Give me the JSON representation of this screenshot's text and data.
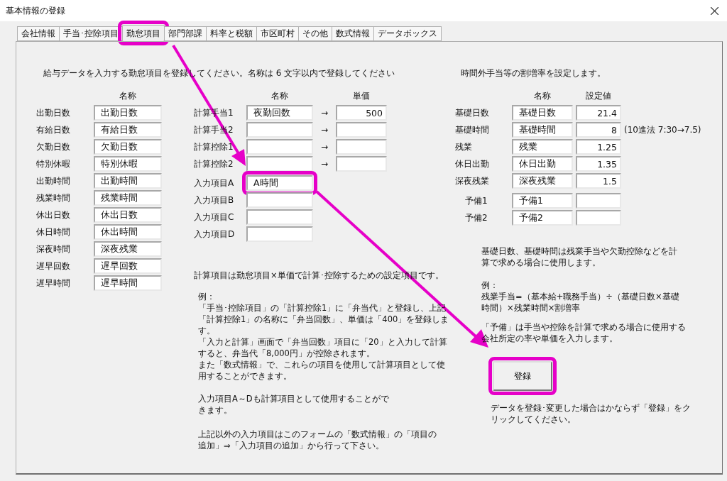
{
  "window": {
    "title": "基本情報の登録"
  },
  "tabs": [
    {
      "label": "会社情報",
      "selected": false,
      "highlighted": false
    },
    {
      "label": "手当･控除項目",
      "selected": false,
      "highlighted": false
    },
    {
      "label": "勤怠項目",
      "selected": true,
      "highlighted": true
    },
    {
      "label": "部門部課",
      "selected": false,
      "highlighted": false
    },
    {
      "label": "料率と税額",
      "selected": false,
      "highlighted": false
    },
    {
      "label": "市区町村",
      "selected": false,
      "highlighted": false
    },
    {
      "label": "その他",
      "selected": false,
      "highlighted": false
    },
    {
      "label": "数式情報",
      "selected": false,
      "highlighted": false
    },
    {
      "label": "データボックス",
      "selected": false,
      "highlighted": false
    }
  ],
  "attendance": {
    "intro": "給与データを入力する勤怠項目を登録してください。名称は 6 文字以内で登録してください",
    "name_header": "名称",
    "rows": [
      {
        "label": "出勤日数",
        "value": "出勤日数"
      },
      {
        "label": "有給日数",
        "value": "有給日数"
      },
      {
        "label": "欠勤日数",
        "value": "欠勤日数"
      },
      {
        "label": "特別休暇",
        "value": "特別休暇"
      },
      {
        "label": "出勤時間",
        "value": "出勤時間"
      },
      {
        "label": "残業時間",
        "value": "残業時間"
      },
      {
        "label": "休出日数",
        "value": "休出日数"
      },
      {
        "label": "休日時間",
        "value": "休出時間"
      },
      {
        "label": "深夜時間",
        "value": "深夜残業"
      },
      {
        "label": "遅早回数",
        "value": "遅早回数"
      },
      {
        "label": "遅早時間",
        "value": "遅早時間"
      }
    ]
  },
  "calc": {
    "name_header": "名称",
    "price_header": "単価",
    "rows": [
      {
        "label": "計算手当1",
        "name": "夜勤回数",
        "arrow": "→",
        "price": "500"
      },
      {
        "label": "計算手当2",
        "name": "",
        "arrow": "→",
        "price": ""
      },
      {
        "label": "計算控除1",
        "name": "",
        "arrow": "→",
        "price": ""
      },
      {
        "label": "計算控除2",
        "name": "",
        "arrow": "→",
        "price": ""
      }
    ],
    "inputs": [
      {
        "label": "入力項目A",
        "value": "A時間",
        "highlighted": true
      },
      {
        "label": "入力項目B",
        "highlighted": false
      },
      {
        "label": "入力項目C",
        "highlighted": false
      },
      {
        "label": "入力項目D",
        "highlighted": false
      }
    ],
    "note": "計算項目は勤怠項目×単価で計算･控除するための設定項目です。",
    "example_title": "例：",
    "example_lines": [
      "「手当･控除項目」の「計算控除1」に「弁当代」と登録し、上記「計算控除1」の名称に「弁当回数」、単価は「400」を登録します。",
      "「入力と計算」画面で「弁当回数」項目に「20」と入力して計算すると、弁当代「8,000円」が控除されます。",
      "また「数式情報」で、これらの項目を使用して計算項目として使用することができます。"
    ],
    "input_note": "入力項目A～Dも計算項目として使用することができます。",
    "other_note": "上記以外の入力項目はこのフォームの「数式情報」の「項目の追加」⇒「入力項目の追加」から行って下さい。"
  },
  "overtime": {
    "intro": "時間外手当等の割増率を設定します。",
    "name_header": "名称",
    "value_header": "設定値",
    "rows": [
      {
        "label": "基礎日数",
        "name": "基礎日数",
        "value": "21.4"
      },
      {
        "label": "基礎時間",
        "name": "基礎時間",
        "value": "8",
        "note": "(10進法  7:30→7.5)"
      },
      {
        "label": "残業",
        "name": "残業",
        "value": "1.25"
      },
      {
        "label": "休日出勤",
        "name": "休日出勤",
        "value": "1.35"
      },
      {
        "label": "深夜残業",
        "name": "深夜残業",
        "value": "1.5"
      }
    ],
    "reserve": [
      {
        "label": "予備1",
        "name": "予備1"
      },
      {
        "label": "予備2",
        "name": "予備2"
      }
    ],
    "note": "基礎日数、基礎時間は残業手当や欠勤控除などを計算で求める場合に使用します。",
    "example_title": "例：",
    "example_text": "残業手当=（基本給+職務手当）÷（基礎日数×基礎時間）×残業時間×割増率",
    "reserve_note": "「予備」は手当や控除を計算で求める場合に使用する会社所定の率や単価を入力します。"
  },
  "register_button": {
    "label": "登録",
    "highlighted": true
  },
  "register_note": "データを登録･変更した場合はかならず「登録」をクリックしてください。"
}
